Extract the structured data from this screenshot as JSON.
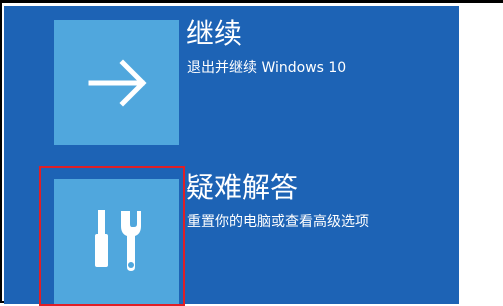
{
  "options": [
    {
      "title": "继续",
      "description": "退出并继续 Windows 10",
      "icon": "arrow-right-icon"
    },
    {
      "title": "疑难解答",
      "description": "重置你的电脑或查看高级选项",
      "icon": "tools-icon"
    }
  ],
  "colors": {
    "panel_background": "#1d63b5",
    "tile_background": "#50a7dd",
    "highlight_border": "#e01f26",
    "text": "#ffffff"
  }
}
